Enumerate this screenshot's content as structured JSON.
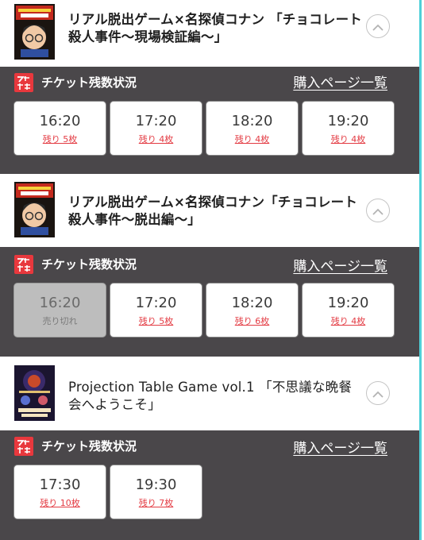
{
  "colors": {
    "panel_bg": "#4a474a",
    "remaining_text": "#e33a42",
    "logo_red": "#e8383d",
    "accent_edge": "#4fd0d8"
  },
  "ticket_panel_title": "チケット残数状況",
  "buy_link_label": "購入ページ一覧",
  "events": [
    {
      "title": "リアル脱出ゲーム×名探偵コナン 「チョコレート殺人事件〜現場検証編〜」",
      "thumbnail_icon": "conan-chocolate-poster",
      "slots": [
        {
          "time": "16:20",
          "status": "残り 5枚",
          "sold_out": false
        },
        {
          "time": "17:20",
          "status": "残り 4枚",
          "sold_out": false
        },
        {
          "time": "18:20",
          "status": "残り 4枚",
          "sold_out": false
        },
        {
          "time": "19:20",
          "status": "残り 4枚",
          "sold_out": false
        }
      ]
    },
    {
      "title": "リアル脱出ゲーム×名探偵コナン「チョコレート殺人事件〜脱出編〜」",
      "thumbnail_icon": "conan-chocolate-poster",
      "slots": [
        {
          "time": "16:20",
          "status": "売り切れ",
          "sold_out": true
        },
        {
          "time": "17:20",
          "status": "残り 5枚",
          "sold_out": false
        },
        {
          "time": "18:20",
          "status": "残り 6枚",
          "sold_out": false
        },
        {
          "time": "19:20",
          "status": "残り 4枚",
          "sold_out": false
        }
      ]
    },
    {
      "title": "Projection Table Game vol.1 「不思議な晩餐会へようこそ」",
      "thumbnail_icon": "projection-dinner-poster",
      "slots": [
        {
          "time": "17:30",
          "status": "残り 10枚",
          "sold_out": false
        },
        {
          "time": "19:30",
          "status": "残り 7枚",
          "sold_out": false
        }
      ]
    }
  ]
}
